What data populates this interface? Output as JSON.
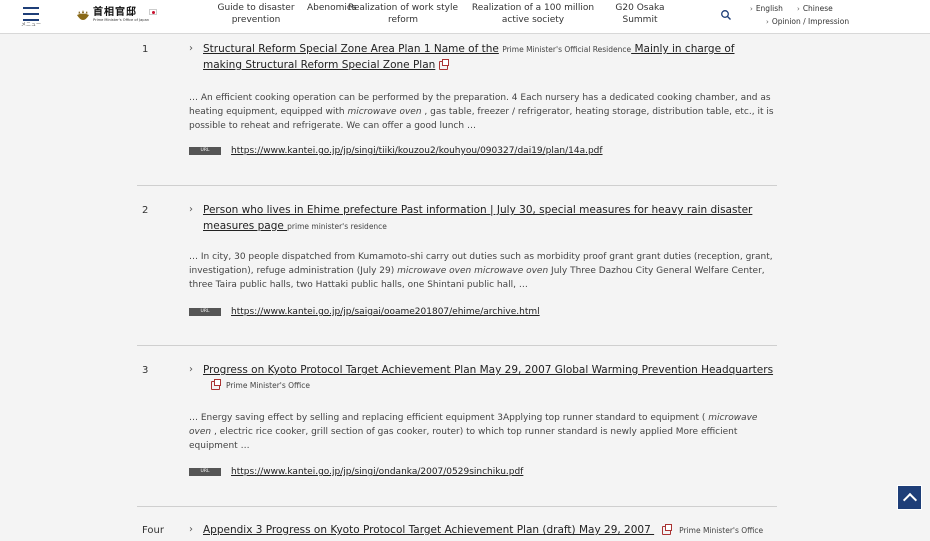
{
  "header": {
    "menu_label": "メニュー",
    "logo_jp": "首相官邸",
    "logo_en": "Prime Minister's Office of Japan",
    "nav": [
      {
        "label": "Guide to disaster prevention"
      },
      {
        "label": "Abenomics"
      },
      {
        "label": "Realization of work style reform"
      },
      {
        "label": "Realization of a 100 million active society"
      },
      {
        "label": "G20 Osaka Summit"
      }
    ],
    "lang": {
      "english": "English",
      "chinese": "Chinese",
      "opinion": "Opinion / Impression"
    }
  },
  "results": [
    {
      "num": "1",
      "title_a": "Structural Reform Special Zone Area Plan 1 Name of the",
      "tag": "Prime Minister's Official Residence",
      "title_b": " Mainly in charge of",
      "title_c": "making Structural Reform Special Zone Plan",
      "snippet": [
        {
          "t": "… An efficient cooking operation can be performed by the preparation. 4 Each nursery has a dedicated cooking chamber, and as heating equipment, equipped with "
        },
        {
          "t": "microwave oven",
          "em": true
        },
        {
          "t": " , gas table, freezer / refrigerator, heating storage, distribution table, etc., it is possible to reheat and refrigerate. We can offer a good lunch …"
        }
      ],
      "url_badge": "URL",
      "url": "https://www.kantei.go.jp/jp/singi/tiiki/kouzou2/kouhyou/090327/dai19/plan/14a.pdf"
    },
    {
      "num": "2",
      "title_a": "Person who lives in Ehime prefecture Past information | July 30, special measures for heavy rain disaster",
      "title_b": "measures page ",
      "tag": "prime minister's residence",
      "snippet": [
        {
          "t": "… In city, 30 people dispatched from Kumamoto-shi carry out duties such as morbidity proof grant grant duties (reception, grant, investigation), refuge administration (July 29) "
        },
        {
          "t": "microwave oven microwave oven",
          "em": true
        },
        {
          "t": " July Three Dazhou City General Welfare Center, three Taira public halls, two Hattaki public halls, one Shintani public hall, …"
        }
      ],
      "url_badge": "URL",
      "url": "https://www.kantei.go.jp/jp/saigai/ooame201807/ehime/archive.html"
    },
    {
      "num": "3",
      "title_a": "Progress on Kyoto Protocol Target Achievement Plan May 29, 2007 Global Warming Prevention Headquarters",
      "tag": "Prime Minister's Office",
      "snippet": [
        {
          "t": "… Energy saving effect by selling and replacing efficient equipment 3Applying top runner standard to equipment ( "
        },
        {
          "t": "microwave oven",
          "em": true
        },
        {
          "t": " , electric rice cooker, grill section of gas cooker, router) to which top runner standard is newly applied More efficient equipment …"
        }
      ],
      "url_badge": "URL",
      "url": "https://www.kantei.go.jp/jp/singi/ondanka/2007/0529sinchiku.pdf"
    },
    {
      "num": "Four",
      "title_a": "Appendix 3 Progress on Kyoto Protocol Target Achievement Plan (draft) May 29, 2007 ",
      "tag": "Prime Minister's Office"
    }
  ]
}
